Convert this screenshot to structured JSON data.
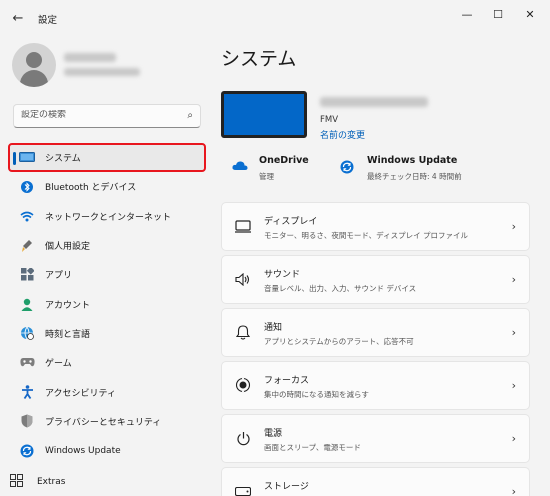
{
  "window": {
    "title": "設定",
    "back_icon": "arrow-left-icon",
    "minimize_glyph": "—",
    "maximize_glyph": "☐",
    "close_glyph": "✕"
  },
  "search": {
    "placeholder": "設定の検索"
  },
  "sidebar": {
    "items": [
      {
        "label": "システム",
        "icon": "monitor-icon",
        "active": true
      },
      {
        "label": "Bluetooth とデバイス",
        "icon": "bluetooth-icon",
        "active": false
      },
      {
        "label": "ネットワークとインターネット",
        "icon": "wifi-icon",
        "active": false
      },
      {
        "label": "個人用設定",
        "icon": "brush-icon",
        "active": false
      },
      {
        "label": "アプリ",
        "icon": "apps-icon",
        "active": false
      },
      {
        "label": "アカウント",
        "icon": "account-icon",
        "active": false
      },
      {
        "label": "時刻と言語",
        "icon": "globe-clock-icon",
        "active": false
      },
      {
        "label": "ゲーム",
        "icon": "gamepad-icon",
        "active": false
      },
      {
        "label": "アクセシビリティ",
        "icon": "accessibility-icon",
        "active": false
      },
      {
        "label": "プライバシーとセキュリティ",
        "icon": "shield-icon",
        "active": false
      },
      {
        "label": "Windows Update",
        "icon": "windows-update-icon",
        "active": false
      }
    ],
    "extras_label": "Extras"
  },
  "main": {
    "title": "システム",
    "device": {
      "model": "FMV",
      "rename_link": "名前の変更"
    },
    "status": {
      "onedrive": {
        "label": "OneDrive",
        "sub": "管理"
      },
      "windows_update": {
        "label": "Windows Update",
        "sub": "最終チェック日時: 4 時間前"
      }
    },
    "cards": [
      {
        "title": "ディスプレイ",
        "sub": "モニター、明るさ、夜間モード、ディスプレイ プロファイル",
        "icon": "display-icon"
      },
      {
        "title": "サウンド",
        "sub": "音量レベル、出力、入力、サウンド デバイス",
        "icon": "speaker-icon"
      },
      {
        "title": "通知",
        "sub": "アプリとシステムからのアラート、応答不可",
        "icon": "bell-icon"
      },
      {
        "title": "フォーカス",
        "sub": "集中の時間になる通知を減らす",
        "icon": "focus-icon"
      },
      {
        "title": "電源",
        "sub": "画面とスリープ、電源モード",
        "icon": "power-icon"
      },
      {
        "title": "ストレージ",
        "sub": "",
        "icon": "storage-icon"
      }
    ]
  },
  "colors": {
    "accent": "#005fb8",
    "highlight_border": "#e8161e",
    "device_screen": "#0367c8",
    "window_bg": "#f3f3f3",
    "card_bg": "#fbfbfb"
  }
}
